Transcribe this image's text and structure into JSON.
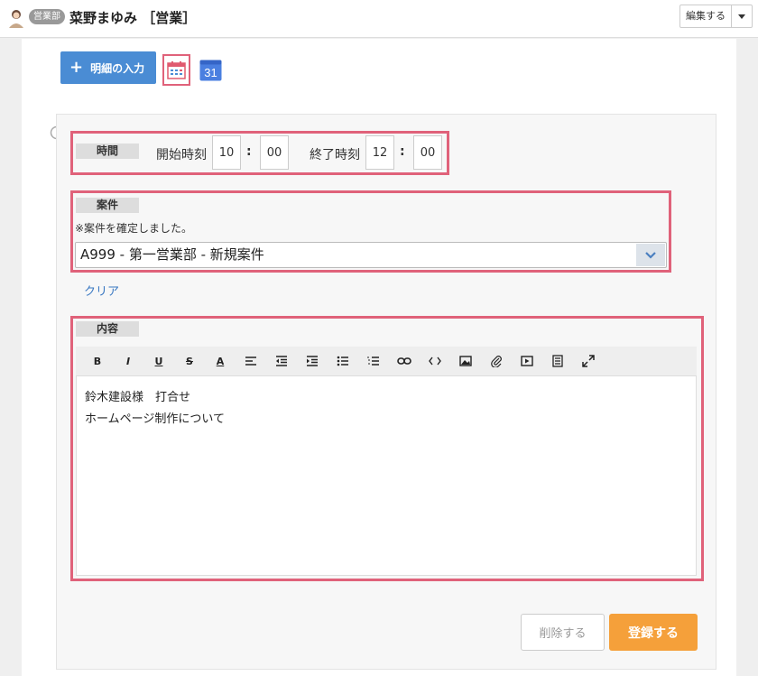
{
  "header": {
    "department_badge": "営業部",
    "user_name": "菜野まゆみ ［営業］",
    "edit_label": "編集する"
  },
  "actions": {
    "add_detail_label": "明細の入力",
    "google_calendar_day": "31"
  },
  "time": {
    "section_label": "時間",
    "start_label": "開始時刻",
    "start_hour": "10",
    "start_minute": "00",
    "end_label": "終了時刻",
    "end_hour": "12",
    "end_minute": "00",
    "separator": ":"
  },
  "case": {
    "section_label": "案件",
    "note": "※案件を確定しました。",
    "selected": "A999 - 第一営業部 - 新規案件",
    "clear_label": "クリア"
  },
  "content": {
    "section_label": "内容",
    "lines": [
      "鈴木建設様　打合せ",
      "ホームページ制作について"
    ]
  },
  "toolbar": {
    "bold": "B",
    "italic": "I",
    "underline": "U",
    "strike": "S",
    "font_color": "A"
  },
  "buttons": {
    "delete_label": "削除する",
    "submit_label": "登録する"
  },
  "colors": {
    "primary": "#4a8cd4",
    "accent_orange": "#f5a03a",
    "highlight": "#e0627a",
    "link": "#3a78c2"
  }
}
